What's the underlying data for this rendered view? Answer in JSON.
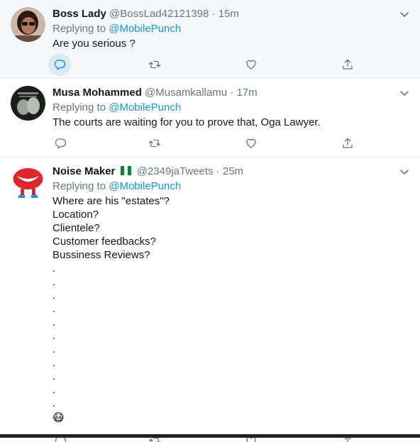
{
  "tweets": [
    {
      "name": "Boss Lady",
      "handle": "@BossLad42121398",
      "dot": "·",
      "time": "15m",
      "reply_prefix": "Replying to",
      "reply_to": "@MobilePunch",
      "lines": [
        "Are you serious ?"
      ]
    },
    {
      "name": "Musa Mohammed",
      "handle": "@Musamkallamu",
      "dot": "·",
      "time": "17m",
      "reply_prefix": "Replying to",
      "reply_to": "@MobilePunch",
      "lines": [
        "The courts are waiting for you to prove that, Oga Lawyer."
      ]
    },
    {
      "name": "Noise Maker",
      "handle": "@2349jaTweets",
      "dot": "·",
      "time": "25m",
      "reply_prefix": "Replying to",
      "reply_to": "@MobilePunch",
      "lines": [
        "Where are his \"estates\"?",
        "Location?",
        "Clientele?",
        "Customer feedbacks?",
        "Bussiness Reviews?",
        ".",
        ".",
        ".",
        ".",
        ".",
        ".",
        ".",
        ".",
        ".",
        ".",
        "."
      ],
      "emoji": "😷"
    }
  ],
  "icons": {
    "reply": "reply-icon",
    "retweet": "retweet-icon",
    "like": "heart-icon",
    "share": "share-icon",
    "caret": "chevron-down-icon",
    "flag": "nigeria-flag-icon"
  },
  "colors": {
    "accent": "#1b95e0",
    "muted": "#657786",
    "hover_bg": "#f5f8fa"
  }
}
